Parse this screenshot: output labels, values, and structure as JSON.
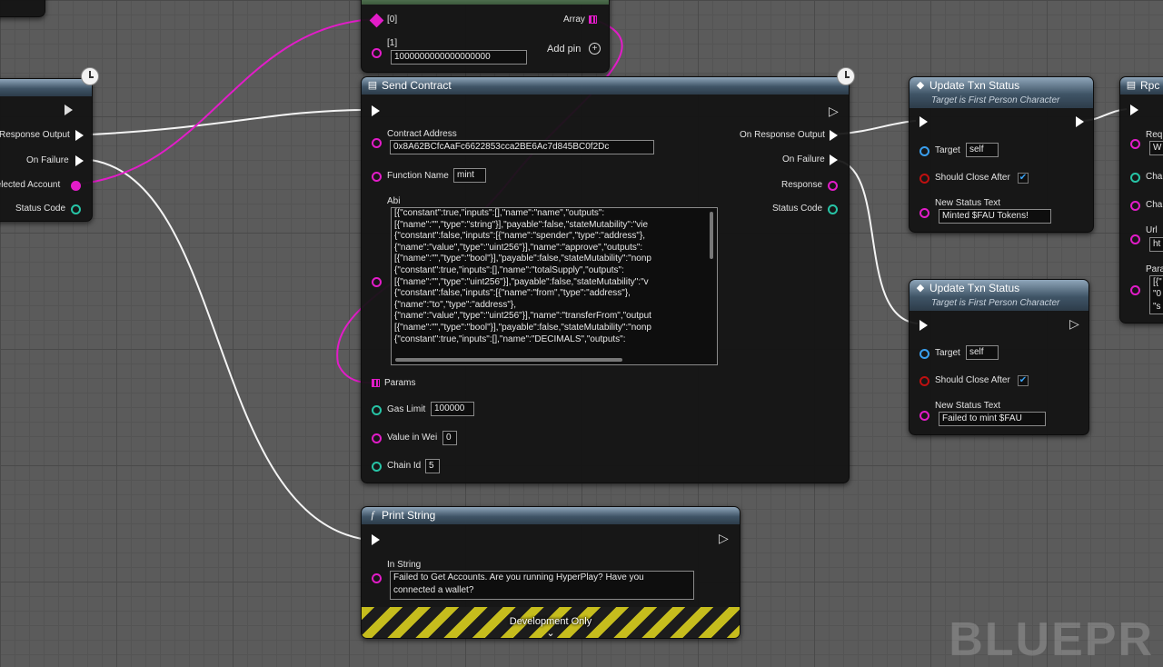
{
  "make_array_node": {
    "pin0_label": "[0]",
    "pin1_label": "[1]",
    "pin1_value": "1000000000000000000",
    "output_label": "Array",
    "add_pin_label": "Add pin"
  },
  "left_node": {
    "response_output_label": "Response Output",
    "on_failure_label": "On Failure",
    "selected_account_label": "Selected Account",
    "status_code_label": "Status Code"
  },
  "send_contract": {
    "title": "Send Contract",
    "contract_address_label": "Contract Address",
    "contract_address_value": "0x8A62BCfcAaFc6622853cca2BE6Ac7d845BC0f2Dc",
    "function_name_label": "Function Name",
    "function_name_value": "mint",
    "abi_label": "Abi",
    "abi_lines": [
      "[{\"constant\":true,\"inputs\":[],\"name\":\"name\",\"outputs\":",
      "[{\"name\":\"\",\"type\":\"string\"}],\"payable\":false,\"stateMutability\":\"vie",
      "{\"constant\":false,\"inputs\":[{\"name\":\"spender\",\"type\":\"address\"},",
      "{\"name\":\"value\",\"type\":\"uint256\"}],\"name\":\"approve\",\"outputs\":",
      "[{\"name\":\"\",\"type\":\"bool\"}],\"payable\":false,\"stateMutability\":\"nonp",
      "{\"constant\":true,\"inputs\":[],\"name\":\"totalSupply\",\"outputs\":",
      "[{\"name\":\"\",\"type\":\"uint256\"}],\"payable\":false,\"stateMutability\":\"v",
      "{\"constant\":false,\"inputs\":[{\"name\":\"from\",\"type\":\"address\"},",
      "{\"name\":\"to\",\"type\":\"address\"},",
      "{\"name\":\"value\",\"type\":\"uint256\"}],\"name\":\"transferFrom\",\"output",
      "[{\"name\":\"\",\"type\":\"bool\"}],\"payable\":false,\"stateMutability\":\"nonp",
      "{\"constant\":true,\"inputs\":[],\"name\":\"DECIMALS\",\"outputs\":"
    ],
    "params_label": "Params",
    "gas_limit_label": "Gas Limit",
    "gas_limit_value": "100000",
    "value_in_wei_label": "Value in Wei",
    "value_in_wei_value": "0",
    "chain_id_label": "Chain Id",
    "chain_id_value": "5",
    "on_response_output_label": "On Response Output",
    "on_failure_label": "On Failure",
    "response_label": "Response",
    "status_code_label": "Status Code"
  },
  "update_txn_status_1": {
    "title": "Update Txn Status",
    "subtitle": "Target is First Person Character",
    "target_label": "Target",
    "target_value": "self",
    "should_close_label": "Should Close After",
    "should_close_checked": "✔",
    "new_status_label": "New Status Text",
    "new_status_value": "Minted $FAU Tokens!"
  },
  "update_txn_status_2": {
    "title": "Update Txn Status",
    "subtitle": "Target is First Person Character",
    "target_label": "Target",
    "target_value": "self",
    "should_close_label": "Should Close After",
    "should_close_checked": "✔",
    "new_status_label": "New Status Text",
    "new_status_value": "Failed to mint $FAU"
  },
  "rpc_node": {
    "title": "Rpc",
    "labels": [
      "Req",
      "Cha",
      "Cha",
      "Url",
      "Para"
    ],
    "field_values": [
      "W",
      "ht",
      "[{\"",
      "\"0",
      "\"s"
    ]
  },
  "print_string": {
    "title": "Print String",
    "in_string_label": "In String",
    "in_string_value_line1": "Failed to Get Accounts. Are you running HyperPlay? Have you",
    "in_string_value_line2": "connected a wallet?",
    "dev_only_label": "Development Only",
    "chevron": "⌄"
  },
  "watermark_text": "BLUEPR",
  "colors": {
    "exec": "#ffffff",
    "string_pin": "#e21cc8",
    "int_pin": "#27c4a6",
    "object_pin": "#3aa0f0",
    "bool_pin": "#c01010",
    "header": "#3f5466"
  },
  "icons": {
    "function": "function-icon",
    "latent": "clock-icon",
    "array": "array-grid-icon",
    "add_pin": "add-pin-icon"
  }
}
